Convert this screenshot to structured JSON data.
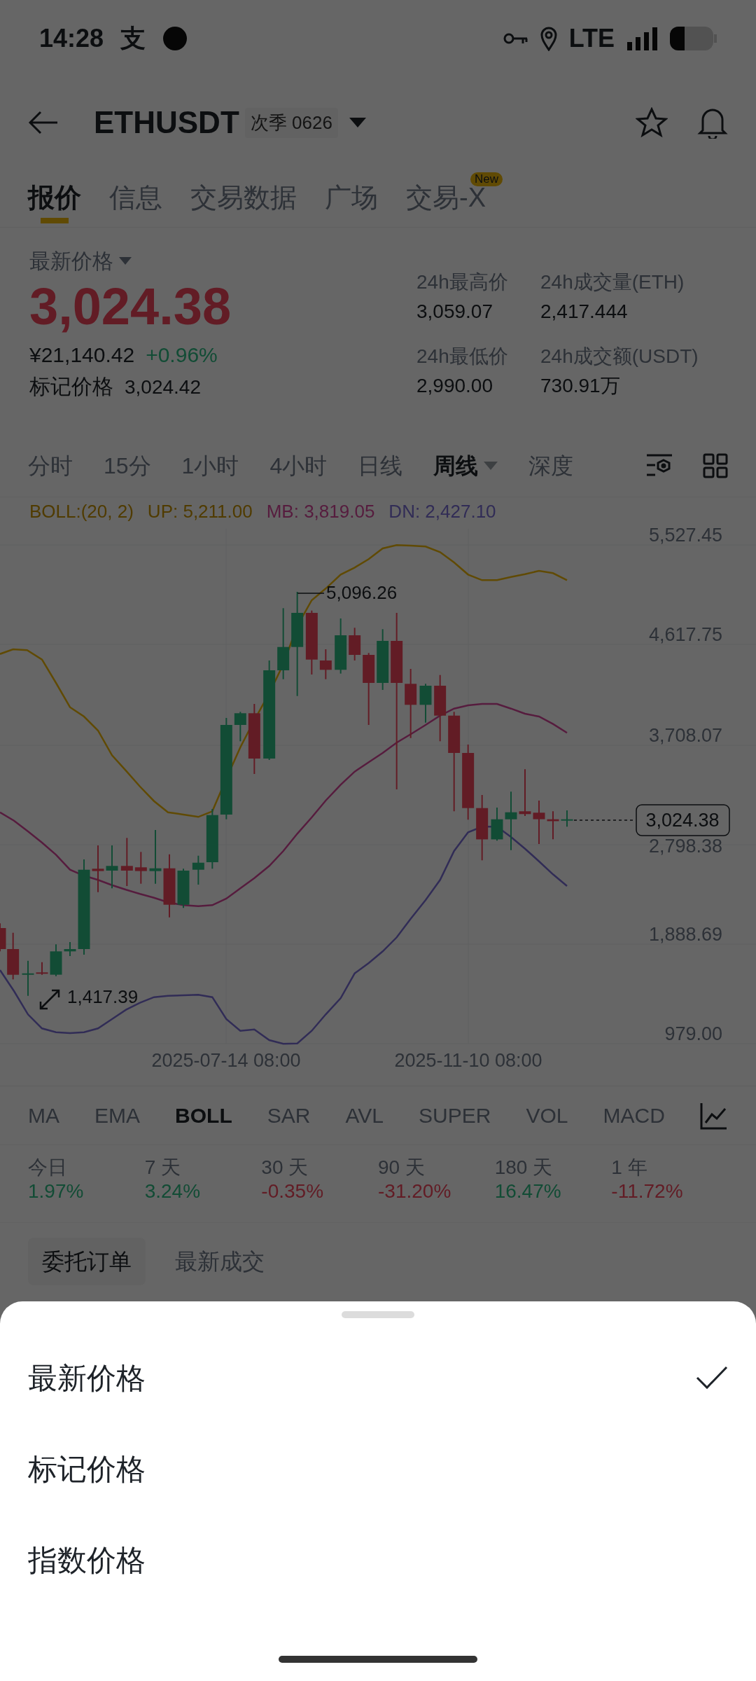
{
  "status_bar": {
    "time": "14:28",
    "app_glyph": "支",
    "network": "LTE"
  },
  "header": {
    "symbol": "ETHUSDT",
    "contract_badge": "次季 0626"
  },
  "tabs": [
    {
      "label": "报价",
      "selected": true
    },
    {
      "label": "信息",
      "selected": false
    },
    {
      "label": "交易数据",
      "selected": false
    },
    {
      "label": "广场",
      "selected": false
    },
    {
      "label": "交易-X",
      "selected": false,
      "badge": "New"
    }
  ],
  "price_panel": {
    "selector_label": "最新价格",
    "last_price": "3,024.38",
    "cny_price": "¥21,140.42",
    "change": "+0.96%",
    "mark_label": "标记价格",
    "mark_price": "3,024.42",
    "stats": [
      {
        "label": "24h最高价",
        "value": "3,059.07"
      },
      {
        "label": "24h成交量(ETH)",
        "value": "2,417.444"
      },
      {
        "label": "24h最低价",
        "value": "2,990.00"
      },
      {
        "label": "24h成交额(USDT)",
        "value": "730.91万"
      }
    ]
  },
  "intervals": [
    {
      "label": "分时",
      "selected": false
    },
    {
      "label": "15分",
      "selected": false
    },
    {
      "label": "1小时",
      "selected": false
    },
    {
      "label": "4小时",
      "selected": false
    },
    {
      "label": "日线",
      "selected": false
    },
    {
      "label": "周线",
      "selected": true,
      "dropdown": true
    },
    {
      "label": "深度",
      "selected": false
    }
  ],
  "indicator_legend": [
    {
      "text": "BOLL:(20, 2)",
      "color": "#503b00"
    },
    {
      "text": "UP: 5,211.00",
      "color": "#503b00"
    },
    {
      "text": "MB: 3,819.05",
      "color": "#561c3e"
    },
    {
      "text": "DN: 2,427.10",
      "color": "#312c56"
    }
  ],
  "chart": {
    "y_labels": [
      "5,527.45",
      "4,617.75",
      "3,708.07",
      "2,798.38",
      "1,888.69",
      "979.00"
    ],
    "x_labels": [
      "2025-07-14 08:00",
      "2025-11-10 08:00"
    ],
    "high_label": "5,096.26",
    "low_label": "1,417.39",
    "current_price": "3,024.38"
  },
  "indicators": [
    {
      "label": "MA",
      "selected": false
    },
    {
      "label": "EMA",
      "selected": false
    },
    {
      "label": "BOLL",
      "selected": true
    },
    {
      "label": "SAR",
      "selected": false
    },
    {
      "label": "AVL",
      "selected": false
    },
    {
      "label": "SUPER",
      "selected": false
    },
    {
      "label": "VOL",
      "selected": false
    },
    {
      "label": "MACD",
      "selected": false
    }
  ],
  "returns": [
    {
      "period": "今日",
      "value": "1.97%",
      "color": "#124c35"
    },
    {
      "period": "7 天",
      "value": "3.24%",
      "color": "#124c35"
    },
    {
      "period": "30 天",
      "value": "-0.35%",
      "color": "#621c25"
    },
    {
      "period": "90 天",
      "value": "-31.20%",
      "color": "#621c25"
    },
    {
      "period": "180 天",
      "value": "16.47%",
      "color": "#124c35"
    },
    {
      "period": "1 年",
      "value": "-11.72%",
      "color": "#621c25"
    }
  ],
  "order_tabs": [
    {
      "label": "委托订单",
      "selected": true
    },
    {
      "label": "最新成交",
      "selected": false
    }
  ],
  "price_type_sheet": {
    "options": [
      {
        "label": "最新价格",
        "selected": true
      },
      {
        "label": "标记价格",
        "selected": false
      },
      {
        "label": "指数价格",
        "selected": false
      }
    ]
  }
}
